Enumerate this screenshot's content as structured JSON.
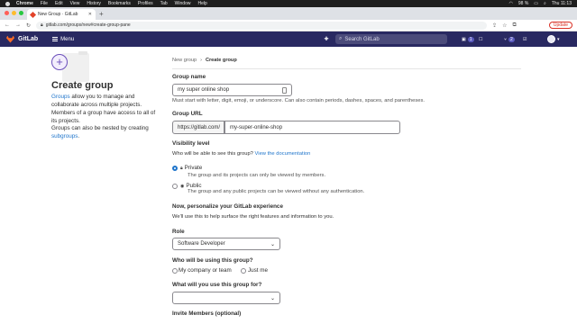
{
  "macos": {
    "app": "Chrome",
    "menus": [
      "File",
      "Edit",
      "View",
      "History",
      "Bookmarks",
      "Profiles",
      "Tab",
      "Window",
      "Help"
    ],
    "battery": "98 %",
    "clock": "Thu 11:13"
  },
  "browser": {
    "tab_title": "New Group · GitLab",
    "url": "gitlab.com/groups/new#create-group-pane",
    "update_label": "Update"
  },
  "gitlab_header": {
    "brand": "GitLab",
    "menu_label": "Menu",
    "search_placeholder": "Search GitLab",
    "issues_count": "1",
    "mr_count": "2"
  },
  "left": {
    "title": "Create group",
    "groups_link": "Groups",
    "desc1_rest": " allow you to manage and collaborate across multiple projects. Members of a group have access to all of its projects.",
    "desc2_pre": "Groups can also be nested by creating ",
    "subgroups_link": "subgroups",
    "desc2_post": "."
  },
  "breadcrumb": {
    "parent": "New group",
    "separator": "›",
    "current": "Create group"
  },
  "form": {
    "group_name_label": "Group name",
    "group_name_value": "my super online shop",
    "group_name_help": "Must start with letter, digit, emoji, or underscore. Can also contain periods, dashes, spaces, and parentheses.",
    "group_url_label": "Group URL",
    "url_prefix": "https://gitlab.com/",
    "url_value": "my-super-online-shop",
    "visibility_label": "Visibility level",
    "visibility_help": "Who will be able to see this group?",
    "visibility_doc_link": "View the documentation",
    "private_label": "Private",
    "private_desc": "The group and its projects can only be viewed by members.",
    "public_label": "Public",
    "public_desc": "The group and any public projects can be viewed without any authentication.",
    "personalize_label": "Now, personalize your GitLab experience",
    "personalize_help": "We'll use this to help surface the right features and information to you.",
    "role_label": "Role",
    "role_value": "Software Developer",
    "who_label": "Who will be using this group?",
    "who_option1": "My company or team",
    "who_option2": "Just me",
    "what_label": "What will you use this group for?",
    "what_value": "",
    "invite_label": "Invite Members (optional)"
  }
}
